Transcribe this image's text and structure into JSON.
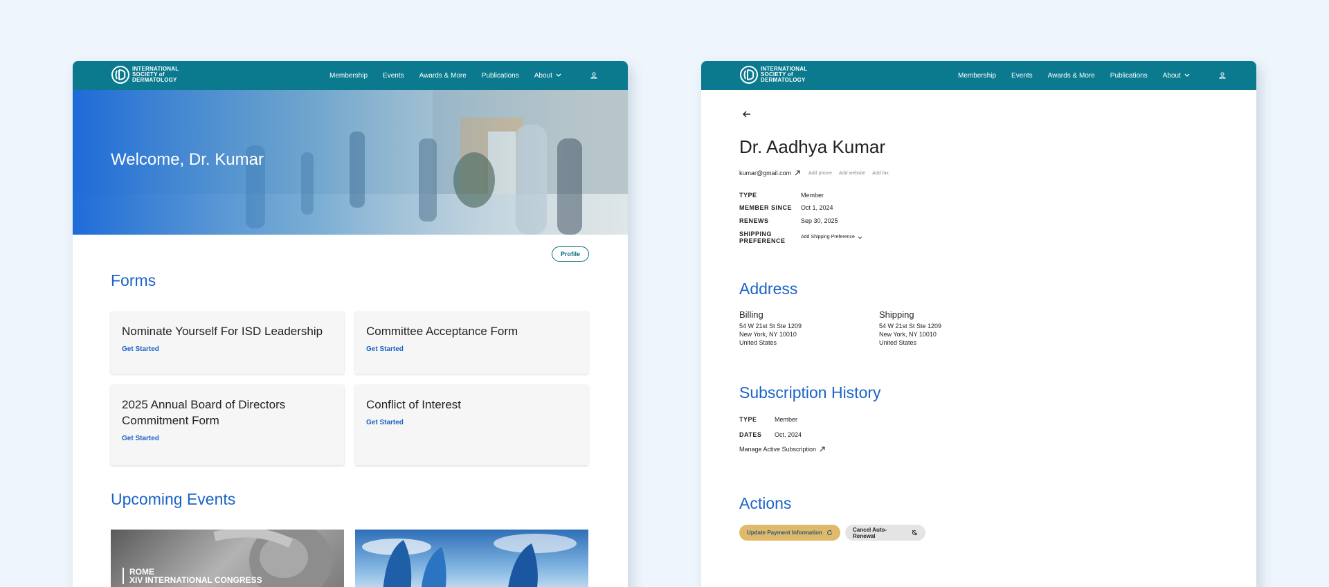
{
  "brand": {
    "org_line1": "INTERNATIONAL",
    "org_line2": "SOCIETY of",
    "org_line3": "DERMATOLOGY"
  },
  "nav": {
    "membership": "Membership",
    "events": "Events",
    "awards": "Awards & More",
    "publications": "Publications",
    "about": "About"
  },
  "dashboard": {
    "welcome": "Welcome, Dr. Kumar",
    "profile_button": "Profile",
    "forms_title": "Forms",
    "forms": [
      {
        "title": "Nominate Yourself For ISD Leadership",
        "action": "Get Started"
      },
      {
        "title": "Committee Acceptance Form",
        "action": "Get Started"
      },
      {
        "title": "2025 Annual Board of Directors Commitment Form",
        "action": "Get Started"
      },
      {
        "title": "Conflict of Interest",
        "action": "Get Started"
      }
    ],
    "events_title": "Upcoming Events",
    "events": [
      {
        "caption_line1": "ROME",
        "caption_line2": "XIV INTERNATIONAL CONGRESS"
      }
    ]
  },
  "profile": {
    "name": "Dr. Aadhya Kumar",
    "email": "kumar@gmail.com",
    "add_phone": "Add phone",
    "add_website": "Add website",
    "add_fax": "Add fax",
    "type_label": "TYPE",
    "type_value": "Member",
    "since_label": "MEMBER SINCE",
    "since_value": "Oct 1, 2024",
    "renews_label": "RENEWS",
    "renews_value": "Sep 30, 2025",
    "shipping_label_1": "SHIPPING",
    "shipping_label_2": "PREFERENCE",
    "shipping_value": "Add Shipping Preference",
    "address_title": "Address",
    "billing": {
      "heading": "Billing",
      "line1": "54 W 21st St Ste 1209",
      "line2": "New York, NY 10010",
      "line3": "United States"
    },
    "shipping": {
      "heading": "Shipping",
      "line1": "54 W 21st St Ste 1209",
      "line2": "New York, NY 10010",
      "line3": "United States"
    },
    "subscription_title": "Subscription History",
    "sub_type_label": "TYPE",
    "sub_type_value": "Member",
    "sub_dates_label": "DATES",
    "sub_dates_value": "Oct, 2024",
    "manage_link": "Manage Active Subscription",
    "actions_title": "Actions",
    "update_payment": "Update Payment Information",
    "cancel_renewal": "Cancel Auto-Renewal"
  },
  "colors": {
    "nav_teal": "#0b7a8f",
    "heading_blue": "#1a63c6",
    "gold_button": "#e0b96a",
    "page_bg": "#eef5fc"
  },
  "icons": [
    "isd-logo-icon",
    "chevron-down-icon",
    "user-icon",
    "back-arrow-icon",
    "external-link-icon",
    "refresh-icon",
    "cancel-renew-icon"
  ]
}
